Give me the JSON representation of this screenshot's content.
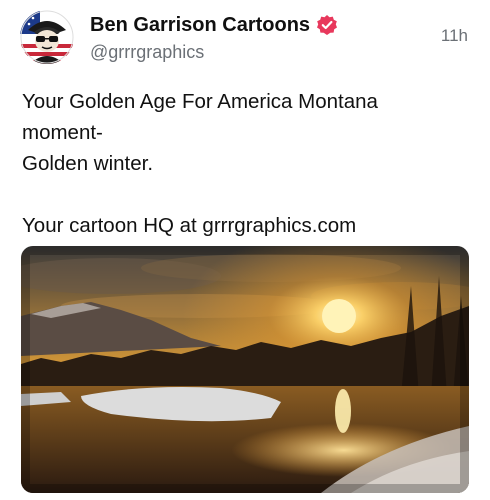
{
  "post": {
    "author": {
      "display_name": "Ben Garrison Cartoons",
      "handle": "@grrrgraphics",
      "verified": true,
      "badge_color": "#e8385c"
    },
    "timestamp": "11h",
    "text_lines": [
      "Your Golden Age For America Montana",
      "moment-",
      "Golden winter.",
      "",
      "Your cartoon HQ at grrrgraphics.com"
    ],
    "media": {
      "icon": "photo-winter-sunset"
    }
  },
  "colors": {
    "text": "#101010",
    "muted": "#6b7076",
    "sun": "#ffe07a",
    "sky_gold": "#c98a2a"
  }
}
